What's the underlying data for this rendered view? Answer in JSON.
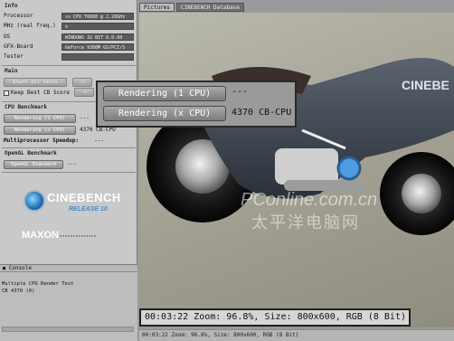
{
  "info": {
    "title": "Info",
    "rows": [
      {
        "label": "Processor",
        "value": "ss CPU T6600 @ 2.20GHz"
      },
      {
        "label": "MHz (real freq.)",
        "value": "x"
      },
      {
        "label": "OS",
        "value": "WINDOWS 32 BIT 6.0.60"
      },
      {
        "label": "GFX-Board",
        "value": "GeForce 9300M GS/PCI/S"
      },
      {
        "label": "Tester",
        "value": ""
      }
    ]
  },
  "main": {
    "title": "Main",
    "start_all": "Start all tests",
    "arrow": "->",
    "keep_best": "Keep Best CB Score"
  },
  "cpu_benchmark": {
    "title": "CPU Benchmark",
    "single_btn": "Rendering (1 CPU)",
    "single_val": "---",
    "multi_btn": "Rendering (x CPU)",
    "multi_val": "4370 CB-CPU",
    "speedup_label": "Multiprocessor Speedup:",
    "speedup_val": "---"
  },
  "opengl": {
    "title": "OpenGL Benchmark",
    "btn": "OpenGL Standard",
    "val": "---"
  },
  "logo": {
    "name": "CINEBENCH",
    "release": "RELEASE 10",
    "maxon": "MAXON"
  },
  "console": {
    "title": "Console",
    "lines": [
      "Multiple CPU Render Test",
      "CB 4370 (0)"
    ]
  },
  "tabs": [
    "Pictures",
    "CINEBENCH Database"
  ],
  "status": "00:03:22 Zoom: 96.8%, Size: 800x600, RGB (8 Bit)",
  "popup": {
    "single_btn": "Rendering (1 CPU)",
    "single_val": "---",
    "multi_btn": "Rendering (x CPU)",
    "multi_val": "4370 CB-CPU"
  },
  "zoom_overlay": "00:03:22 Zoom: 96.8%, Size: 800x600, RGB (8 Bit)",
  "watermark": {
    "site": "PConline.com.cn",
    "cn": "太平洋电脑网",
    "bike_brand": "CINEBE"
  },
  "colors": {
    "accent_blue": "#1f6fb2",
    "panel_bg": "#c9c9c9",
    "field_bg": "#5b5b5b"
  }
}
